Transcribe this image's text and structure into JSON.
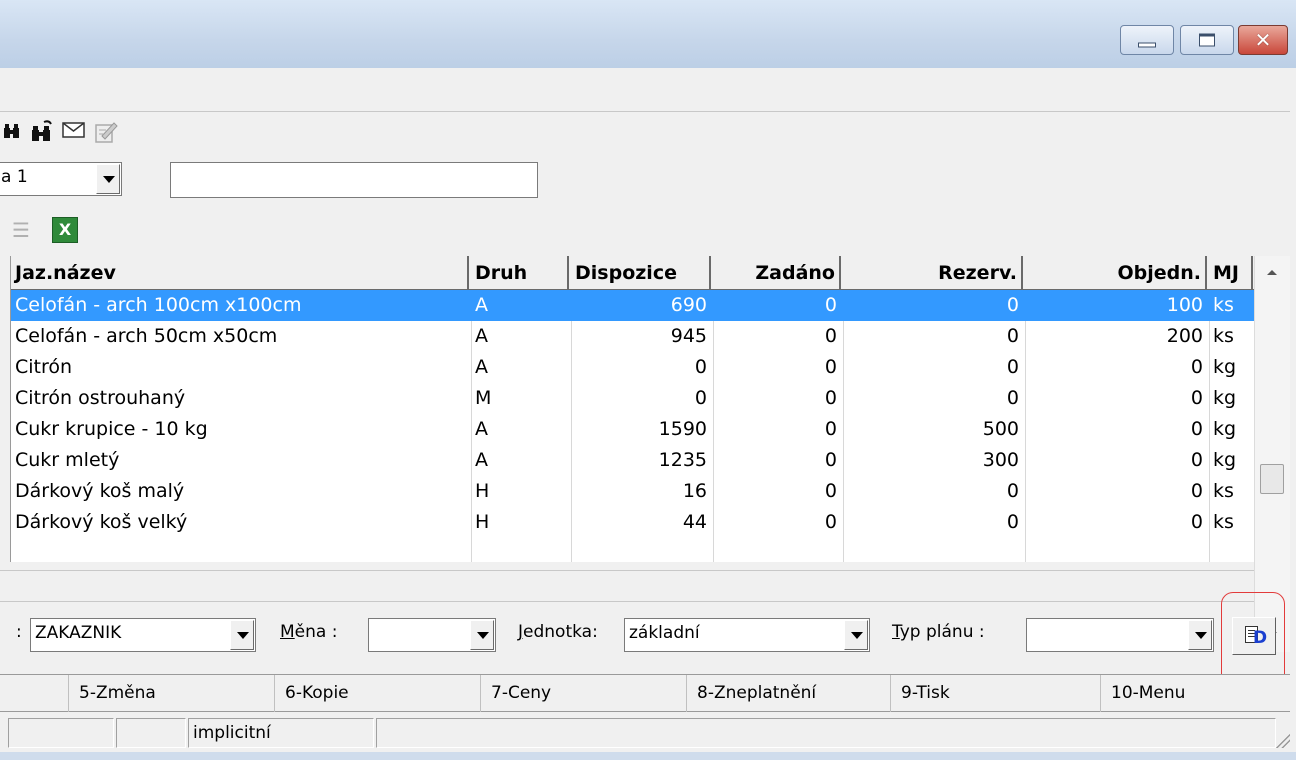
{
  "window": {
    "controls": {
      "minimize_icon": "minimize-icon",
      "maximize_icon": "maximize-icon",
      "close_glyph": "✕"
    }
  },
  "toolbar": {
    "icons": [
      "binoculars-icon",
      "binoculars-replace-icon",
      "envelope-icon",
      "edit-note-icon"
    ]
  },
  "selector": {
    "value": "a 1",
    "text_value": ""
  },
  "grid": {
    "columns": [
      "Jaz.název",
      "Druh",
      "Dispozice",
      "Zadáno",
      "Rezerv.",
      "Objedn.",
      "MJ"
    ],
    "rows": [
      {
        "name": "Celofán - arch 100cm x100cm",
        "druh": "A",
        "dispozice": "690",
        "zadano": "0",
        "rezerv": "0",
        "objedn": "100",
        "mj": "ks",
        "selected": true
      },
      {
        "name": "Celofán - arch 50cm x50cm",
        "druh": "A",
        "dispozice": "945",
        "zadano": "0",
        "rezerv": "0",
        "objedn": "200",
        "mj": "ks"
      },
      {
        "name": "Citrón",
        "druh": "A",
        "dispozice": "0",
        "zadano": "0",
        "rezerv": "0",
        "objedn": "0",
        "mj": "kg"
      },
      {
        "name": "Citrón ostrouhaný",
        "druh": "M",
        "dispozice": "0",
        "zadano": "0",
        "rezerv": "0",
        "objedn": "0",
        "mj": "kg"
      },
      {
        "name": "Cukr krupice - 10 kg",
        "druh": "A",
        "dispozice": "1590",
        "zadano": "0",
        "rezerv": "500",
        "objedn": "0",
        "mj": "kg"
      },
      {
        "name": "Cukr mletý",
        "druh": "A",
        "dispozice": "1235",
        "zadano": "0",
        "rezerv": "300",
        "objedn": "0",
        "mj": "kg"
      },
      {
        "name": "Dárkový koš malý",
        "druh": "H",
        "dispozice": "16",
        "zadano": "0",
        "rezerv": "0",
        "objedn": "0",
        "mj": "ks"
      },
      {
        "name": "Dárkový koš velký",
        "druh": "H",
        "dispozice": "44",
        "zadano": "0",
        "rezerv": "0",
        "objedn": "0",
        "mj": "ks"
      }
    ]
  },
  "filters": {
    "customer_prefix": ":",
    "customer_value": "ZAKAZNIK",
    "currency_label": "Měna :",
    "currency_value": "",
    "unit_label": "Jednotka:",
    "unit_value": "základní",
    "plan_type_label": "Typ plánu :",
    "plan_type_value": "",
    "d_button_glyph": "D"
  },
  "function_keys": [
    "5-Změna",
    "6-Kopie",
    "7-Ceny",
    "8-Zneplatnění",
    "9-Tisk",
    "10-Menu"
  ],
  "status": {
    "panel_1": "",
    "panel_2": "",
    "panel_3": "implicitní",
    "panel_4": ""
  },
  "colors": {
    "selection": "#3399ff",
    "highlight_ring": "#e23b3b",
    "title_bar": "#c6d6ea"
  }
}
